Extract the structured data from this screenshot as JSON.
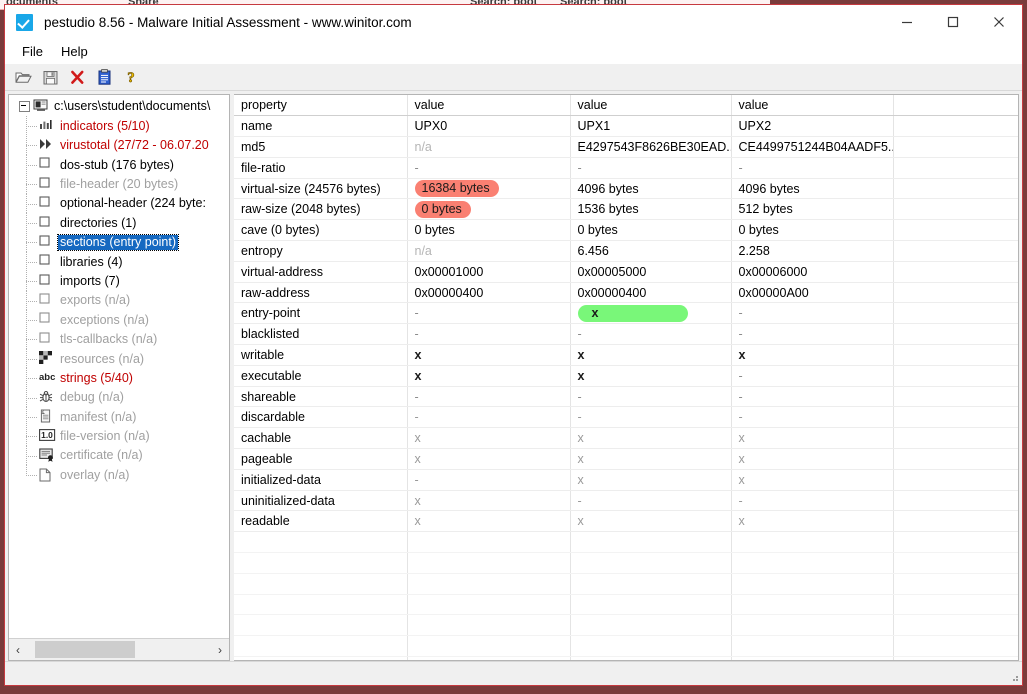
{
  "background_window": {
    "fragments": [
      "ocuments",
      "Share",
      "Search: boot",
      "Search: boot"
    ]
  },
  "window": {
    "title": "pestudio 8.56 - Malware Initial Assessment - www.winitor.com",
    "app_icon": "checkbox-check-icon",
    "controls": {
      "minimize": "minimize-icon",
      "maximize": "maximize-icon",
      "close": "close-icon"
    }
  },
  "menu": {
    "items": [
      {
        "label": "File"
      },
      {
        "label": "Help"
      }
    ]
  },
  "toolbar": {
    "buttons": [
      {
        "name": "open-file-icon",
        "title": "open"
      },
      {
        "name": "save-icon",
        "title": "save"
      },
      {
        "name": "close-file-icon",
        "title": "close"
      },
      {
        "name": "clipboard-icon",
        "title": "report"
      },
      {
        "name": "help-icon",
        "title": "about"
      }
    ]
  },
  "tree": {
    "root": {
      "label": "c:\\users\\student\\documents\\",
      "icon": "computer-icon",
      "expanded": true
    },
    "items": [
      {
        "label": "indicators (5/10)",
        "icon": "chart-icon",
        "color": "red",
        "selected": false
      },
      {
        "label": "virustotal (27/72 - 06.07.20",
        "icon": "forward-icon",
        "color": "red",
        "selected": false
      },
      {
        "label": "dos-stub (176 bytes)",
        "icon": "box-icon",
        "color": "black",
        "selected": false
      },
      {
        "label": "file-header (20 bytes)",
        "icon": "box-icon",
        "color": "grey",
        "selected": false
      },
      {
        "label": "optional-header (224 byte:",
        "icon": "box-icon",
        "color": "black",
        "selected": false
      },
      {
        "label": "directories (1)",
        "icon": "box-icon",
        "color": "black",
        "selected": false
      },
      {
        "label": "sections (entry point)",
        "icon": "box-icon",
        "color": "black",
        "selected": true
      },
      {
        "label": "libraries (4)",
        "icon": "box-icon",
        "color": "black",
        "selected": false
      },
      {
        "label": "imports (7)",
        "icon": "box-icon",
        "color": "black",
        "selected": false
      },
      {
        "label": "exports (n/a)",
        "icon": "box-icon",
        "color": "grey",
        "selected": false
      },
      {
        "label": "exceptions (n/a)",
        "icon": "box-icon",
        "color": "grey",
        "selected": false
      },
      {
        "label": "tls-callbacks (n/a)",
        "icon": "box-icon",
        "color": "grey",
        "selected": false
      },
      {
        "label": "resources (n/a)",
        "icon": "checkerboard-icon",
        "color": "grey",
        "selected": false
      },
      {
        "label": "strings (5/40)",
        "icon": "abc-icon",
        "color": "red",
        "selected": false
      },
      {
        "label": "debug (n/a)",
        "icon": "bug-icon",
        "color": "grey",
        "selected": false
      },
      {
        "label": "manifest (n/a)",
        "icon": "scroll-icon",
        "color": "grey",
        "selected": false
      },
      {
        "label": "file-version (n/a)",
        "icon": "version-icon",
        "color": "grey",
        "selected": false
      },
      {
        "label": "certificate (n/a)",
        "icon": "certificate-icon",
        "color": "grey",
        "selected": false
      },
      {
        "label": "overlay (n/a)",
        "icon": "page-icon",
        "color": "grey",
        "selected": false
      }
    ],
    "scrollbar": {
      "left_arrow": "‹",
      "right_arrow": "›"
    }
  },
  "table": {
    "headers": [
      "property",
      "value",
      "value",
      "value",
      ""
    ],
    "rows": [
      {
        "property": "name",
        "values": [
          "UPX0",
          "UPX1",
          "UPX2"
        ],
        "styles": [
          "normal",
          "normal",
          "normal"
        ]
      },
      {
        "property": "md5",
        "values": [
          "n/a",
          "E4297543F8626BE30EAD...",
          "CE4499751244B04AADF5..."
        ],
        "styles": [
          "na",
          "normal",
          "normal"
        ]
      },
      {
        "property": "file-ratio",
        "values": [
          "-",
          "-",
          "-"
        ],
        "styles": [
          "dim",
          "dim",
          "dim"
        ]
      },
      {
        "property": "virtual-size (24576 bytes)",
        "values": [
          "16384 bytes",
          "4096 bytes",
          "4096 bytes"
        ],
        "styles": [
          "pill-red",
          "normal",
          "normal"
        ]
      },
      {
        "property": "raw-size (2048 bytes)",
        "values": [
          "0 bytes",
          "1536 bytes",
          "512 bytes"
        ],
        "styles": [
          "pill-red",
          "normal",
          "normal"
        ]
      },
      {
        "property": "cave (0 bytes)",
        "values": [
          "0 bytes",
          "0 bytes",
          "0 bytes"
        ],
        "styles": [
          "normal",
          "normal",
          "normal"
        ]
      },
      {
        "property": "entropy",
        "values": [
          "n/a",
          "6.456",
          "2.258"
        ],
        "styles": [
          "na",
          "normal",
          "normal"
        ]
      },
      {
        "property": "virtual-address",
        "values": [
          "0x00001000",
          "0x00005000",
          "0x00006000"
        ],
        "styles": [
          "normal",
          "normal",
          "normal"
        ]
      },
      {
        "property": "raw-address",
        "values": [
          "0x00000400",
          "0x00000400",
          "0x00000A00"
        ],
        "styles": [
          "normal",
          "normal",
          "normal"
        ]
      },
      {
        "property": "entry-point",
        "values": [
          "-",
          "x",
          "-"
        ],
        "styles": [
          "dim",
          "pill-green",
          "dim"
        ]
      },
      {
        "property": "blacklisted",
        "values": [
          "-",
          "-",
          "-"
        ],
        "styles": [
          "dim",
          "dim",
          "dim"
        ]
      },
      {
        "property": "writable",
        "values": [
          "x",
          "x",
          "x"
        ],
        "styles": [
          "xbold",
          "xbold",
          "xbold"
        ]
      },
      {
        "property": "executable",
        "values": [
          "x",
          "x",
          "-"
        ],
        "styles": [
          "xbold",
          "xbold",
          "dim"
        ]
      },
      {
        "property": "shareable",
        "values": [
          "-",
          "-",
          "-"
        ],
        "styles": [
          "dim",
          "dim",
          "dim"
        ]
      },
      {
        "property": "discardable",
        "values": [
          "-",
          "-",
          "-"
        ],
        "styles": [
          "xdim",
          "xdim",
          "xdim"
        ]
      },
      {
        "property": "cachable",
        "values": [
          "x",
          "x",
          "x"
        ],
        "styles": [
          "xdim",
          "xdim",
          "xdim"
        ]
      },
      {
        "property": "pageable",
        "values": [
          "x",
          "x",
          "x"
        ],
        "styles": [
          "xdim",
          "xdim",
          "xdim"
        ]
      },
      {
        "property": "initialized-data",
        "values": [
          "-",
          "x",
          "x"
        ],
        "styles": [
          "xdim",
          "xdim",
          "xdim"
        ]
      },
      {
        "property": "uninitialized-data",
        "values": [
          "x",
          "-",
          "-"
        ],
        "styles": [
          "xdim",
          "xdim",
          "xdim"
        ]
      },
      {
        "property": "readable",
        "values": [
          "x",
          "x",
          "x"
        ],
        "styles": [
          "xdim",
          "xdim",
          "xdim"
        ]
      }
    ],
    "empty_rows": 8
  },
  "colors": {
    "window_border": "#c6393f",
    "selection_blue": "#1669c1",
    "alert_red_text": "#c00000",
    "pill_red": "#fa8072",
    "pill_green": "#79f779",
    "disabled_grey": "#a0a0a0"
  }
}
